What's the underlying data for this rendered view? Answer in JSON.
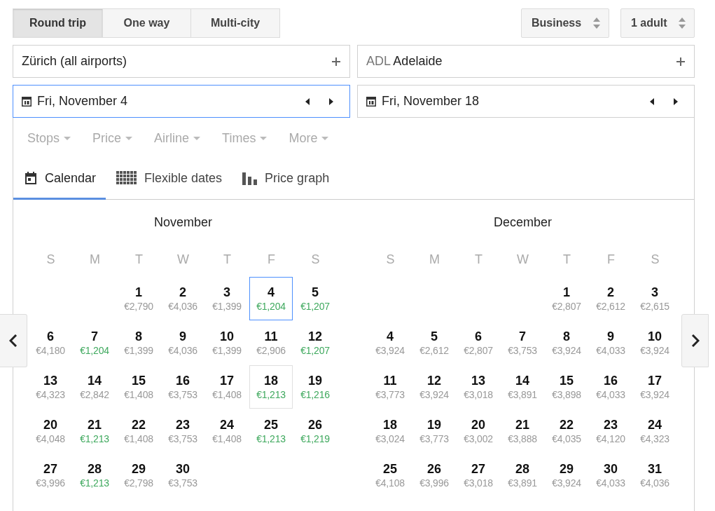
{
  "trip_types": [
    {
      "label": "Round trip",
      "selected": true
    },
    {
      "label": "One way",
      "selected": false
    },
    {
      "label": "Multi-city",
      "selected": false
    }
  ],
  "cabin": {
    "value": "Business"
  },
  "passengers": {
    "value": "1 adult"
  },
  "origin": {
    "name": "Zürich",
    "note": "(all airports)"
  },
  "destination": {
    "code": "ADL",
    "name": "Adelaide"
  },
  "dates": [
    {
      "value": "Fri, November 4",
      "focused": true
    },
    {
      "value": "Fri, November 18",
      "focused": false
    }
  ],
  "filters": [
    "Stops",
    "Price",
    "Airline",
    "Times",
    "More"
  ],
  "tabs": [
    {
      "label": "Calendar",
      "kind": "calendar",
      "selected": true
    },
    {
      "label": "Flexible dates",
      "kind": "grid",
      "selected": false
    },
    {
      "label": "Price graph",
      "kind": "graph",
      "selected": false
    }
  ],
  "months": [
    {
      "title": "November",
      "weekdays": [
        "S",
        "M",
        "T",
        "W",
        "T",
        "F",
        "S"
      ],
      "weeks": [
        {
          "kind": "first",
          "days": [
            {
              "day": "1",
              "price": "€2,790",
              "cheap": false,
              "selected": false,
              "return": false
            },
            {
              "day": "2",
              "price": "€4,036",
              "cheap": false,
              "selected": false,
              "return": false
            },
            {
              "day": "3",
              "price": "€1,399",
              "cheap": false,
              "selected": false,
              "return": false
            },
            {
              "day": "4",
              "price": "€1,204",
              "cheap": true,
              "selected": true,
              "return": false
            },
            {
              "day": "5",
              "price": "€1,207",
              "cheap": true,
              "selected": false,
              "return": false
            }
          ]
        },
        [
          {
            "day": "6",
            "price": "€4,180",
            "cheap": false,
            "selected": false,
            "return": false
          },
          {
            "day": "7",
            "price": "€1,204",
            "cheap": true,
            "selected": false,
            "return": false
          },
          {
            "day": "8",
            "price": "€1,399",
            "cheap": false,
            "selected": false,
            "return": false
          },
          {
            "day": "9",
            "price": "€4,036",
            "cheap": false,
            "selected": false,
            "return": false
          },
          {
            "day": "10",
            "price": "€1,399",
            "cheap": false,
            "selected": false,
            "return": false
          },
          {
            "day": "11",
            "price": "€2,906",
            "cheap": false,
            "selected": false,
            "return": false
          },
          {
            "day": "12",
            "price": "€1,207",
            "cheap": true,
            "selected": false,
            "return": false
          }
        ],
        [
          {
            "day": "13",
            "price": "€4,323",
            "cheap": false,
            "selected": false,
            "return": false
          },
          {
            "day": "14",
            "price": "€2,842",
            "cheap": false,
            "selected": false,
            "return": false
          },
          {
            "day": "15",
            "price": "€1,408",
            "cheap": false,
            "selected": false,
            "return": false
          },
          {
            "day": "16",
            "price": "€3,753",
            "cheap": false,
            "selected": false,
            "return": false
          },
          {
            "day": "17",
            "price": "€1,408",
            "cheap": false,
            "selected": false,
            "return": false
          },
          {
            "day": "18",
            "price": "€1,213",
            "cheap": true,
            "selected": false,
            "return": true
          },
          {
            "day": "19",
            "price": "€1,216",
            "cheap": true,
            "selected": false,
            "return": false
          }
        ],
        [
          {
            "day": "20",
            "price": "€4,048",
            "cheap": false,
            "selected": false,
            "return": false
          },
          {
            "day": "21",
            "price": "€1,213",
            "cheap": true,
            "selected": false,
            "return": false
          },
          {
            "day": "22",
            "price": "€1,408",
            "cheap": false,
            "selected": false,
            "return": false
          },
          {
            "day": "23",
            "price": "€3,753",
            "cheap": false,
            "selected": false,
            "return": false
          },
          {
            "day": "24",
            "price": "€1,408",
            "cheap": false,
            "selected": false,
            "return": false
          },
          {
            "day": "25",
            "price": "€1,213",
            "cheap": true,
            "selected": false,
            "return": false
          },
          {
            "day": "26",
            "price": "€1,219",
            "cheap": true,
            "selected": false,
            "return": false
          }
        ],
        [
          {
            "day": "27",
            "price": "€3,996",
            "cheap": false,
            "selected": false,
            "return": false
          },
          {
            "day": "28",
            "price": "€1,213",
            "cheap": true,
            "selected": false,
            "return": false
          },
          {
            "day": "29",
            "price": "€2,798",
            "cheap": false,
            "selected": false,
            "return": false
          },
          {
            "day": "30",
            "price": "€3,753",
            "cheap": false,
            "selected": false,
            "return": false
          }
        ]
      ]
    },
    {
      "title": "December",
      "weekdays": [
        "S",
        "M",
        "T",
        "W",
        "T",
        "F",
        "S"
      ],
      "weeks": [
        {
          "kind": "first",
          "days": [
            {
              "day": "1",
              "price": "€2,807",
              "cheap": false,
              "selected": false,
              "return": false
            },
            {
              "day": "2",
              "price": "€2,612",
              "cheap": false,
              "selected": false,
              "return": false
            },
            {
              "day": "3",
              "price": "€2,615",
              "cheap": false,
              "selected": false,
              "return": false
            }
          ]
        },
        [
          {
            "day": "4",
            "price": "€3,924",
            "cheap": false,
            "selected": false,
            "return": false
          },
          {
            "day": "5",
            "price": "€2,612",
            "cheap": false,
            "selected": false,
            "return": false
          },
          {
            "day": "6",
            "price": "€2,807",
            "cheap": false,
            "selected": false,
            "return": false
          },
          {
            "day": "7",
            "price": "€3,753",
            "cheap": false,
            "selected": false,
            "return": false
          },
          {
            "day": "8",
            "price": "€3,924",
            "cheap": false,
            "selected": false,
            "return": false
          },
          {
            "day": "9",
            "price": "€4,033",
            "cheap": false,
            "selected": false,
            "return": false
          },
          {
            "day": "10",
            "price": "€3,924",
            "cheap": false,
            "selected": false,
            "return": false
          }
        ],
        [
          {
            "day": "11",
            "price": "€3,773",
            "cheap": false,
            "selected": false,
            "return": false
          },
          {
            "day": "12",
            "price": "€3,924",
            "cheap": false,
            "selected": false,
            "return": false
          },
          {
            "day": "13",
            "price": "€3,018",
            "cheap": false,
            "selected": false,
            "return": false
          },
          {
            "day": "14",
            "price": "€3,891",
            "cheap": false,
            "selected": false,
            "return": false
          },
          {
            "day": "15",
            "price": "€3,898",
            "cheap": false,
            "selected": false,
            "return": false
          },
          {
            "day": "16",
            "price": "€4,033",
            "cheap": false,
            "selected": false,
            "return": false
          },
          {
            "day": "17",
            "price": "€3,924",
            "cheap": false,
            "selected": false,
            "return": false
          }
        ],
        [
          {
            "day": "18",
            "price": "€3,024",
            "cheap": false,
            "selected": false,
            "return": false
          },
          {
            "day": "19",
            "price": "€3,773",
            "cheap": false,
            "selected": false,
            "return": false
          },
          {
            "day": "20",
            "price": "€3,002",
            "cheap": false,
            "selected": false,
            "return": false
          },
          {
            "day": "21",
            "price": "€3,888",
            "cheap": false,
            "selected": false,
            "return": false
          },
          {
            "day": "22",
            "price": "€4,035",
            "cheap": false,
            "selected": false,
            "return": false
          },
          {
            "day": "23",
            "price": "€4,120",
            "cheap": false,
            "selected": false,
            "return": false
          },
          {
            "day": "24",
            "price": "€4,323",
            "cheap": false,
            "selected": false,
            "return": false
          }
        ],
        [
          {
            "day": "25",
            "price": "€4,108",
            "cheap": false,
            "selected": false,
            "return": false
          },
          {
            "day": "26",
            "price": "€3,996",
            "cheap": false,
            "selected": false,
            "return": false
          },
          {
            "day": "27",
            "price": "€3,018",
            "cheap": false,
            "selected": false,
            "return": false
          },
          {
            "day": "28",
            "price": "€3,891",
            "cheap": false,
            "selected": false,
            "return": false
          },
          {
            "day": "29",
            "price": "€3,924",
            "cheap": false,
            "selected": false,
            "return": false
          },
          {
            "day": "30",
            "price": "€4,033",
            "cheap": false,
            "selected": false,
            "return": false
          },
          {
            "day": "31",
            "price": "€4,036",
            "cheap": false,
            "selected": false,
            "return": false
          }
        ]
      ]
    }
  ]
}
